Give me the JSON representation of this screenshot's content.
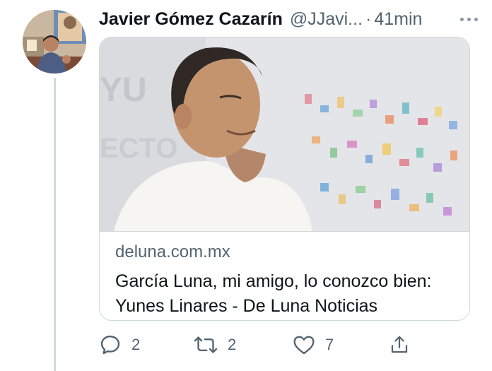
{
  "tweet": {
    "author_name": "Javier Gómez Cazarín",
    "handle": "@JJavi...",
    "separator": "·",
    "time": "41min"
  },
  "card": {
    "domain": "deluna.com.mx",
    "title": "García Luna, mi amigo, lo conozco bien: Yunes Linares - De Luna Noticias"
  },
  "actions": {
    "reply_count": "2",
    "retweet_count": "2",
    "like_count": "7"
  },
  "icons": {
    "reply": "comment-icon",
    "retweet": "retweet-icon",
    "like": "heart-icon",
    "share": "share-icon",
    "more": "more-dots-icon"
  },
  "colors": {
    "secondary_text": "#536471",
    "border": "#cfd9de",
    "thread_line": "#cfd9de"
  }
}
